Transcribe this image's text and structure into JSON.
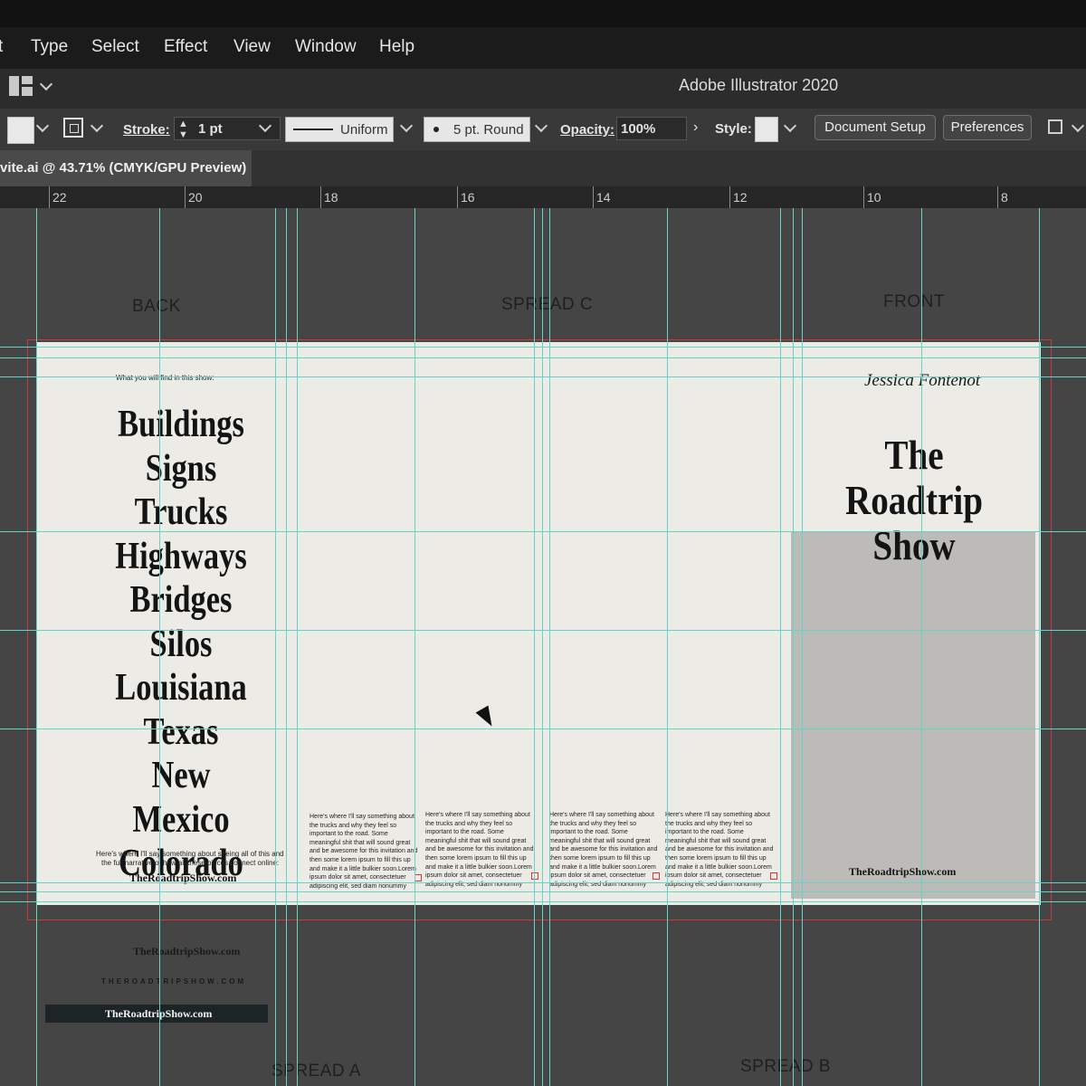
{
  "menu": [
    "t",
    "Type",
    "Select",
    "Effect",
    "View",
    "Window",
    "Help"
  ],
  "app_title": "Adobe Illustrator 2020",
  "control": {
    "stroke_label": "Stroke:",
    "stroke_value": "1 pt",
    "profile": "Uniform",
    "brush": "5 pt. Round",
    "opacity_label": "Opacity:",
    "opacity_value": "100%",
    "style_label": "Style:",
    "document_setup": "Document Setup",
    "preferences": "Preferences"
  },
  "doc_tab": "vite.ai @ 43.71% (CMYK/GPU Preview)",
  "ruler": [
    "22",
    "20",
    "18",
    "16",
    "14",
    "12",
    "10",
    "8"
  ],
  "sections": {
    "back": "BACK",
    "spread_c": "SPREAD C",
    "front": "FRONT",
    "spread_a": "SPREAD A",
    "spread_b": "SPREAD B"
  },
  "back_panel": {
    "intro": "What you will find in this show:",
    "places": [
      "Buildings",
      "Signs",
      "Trucks",
      "Highways",
      "Bridges",
      "Silos",
      "Louisiana",
      "Texas",
      "New Mexico",
      "Colorado"
    ],
    "blurb_1": "Here's where I'll say something about seeing all of this and",
    "blurb_2": "the full narrative of how all these pieces connect online:",
    "url": "TheRoadtripShow.com"
  },
  "columns_text": "Here's where I'll say something about the trucks and why they feel so important to the road. Some meaningful shit that will sound great and be awesome for this invitation and then some lorem ipsum to fill this up and make it a little bulkier soon.Lorem ipsum dolor sit amet, consectetuer adipiscing elit, sed diam nonummy nibh euismod tincidunt ut",
  "front_panel": {
    "signature": "Jessica Fontenot",
    "title_1": "The Roadtrip",
    "title_2": "Show",
    "url": "TheRoadtripShow.com"
  },
  "pasteboard": {
    "url_1": "TheRoadtripShow.com",
    "url_2": "THEROADTRIPSHOW.COM",
    "url_3": "TheRoadtripShow.com"
  }
}
